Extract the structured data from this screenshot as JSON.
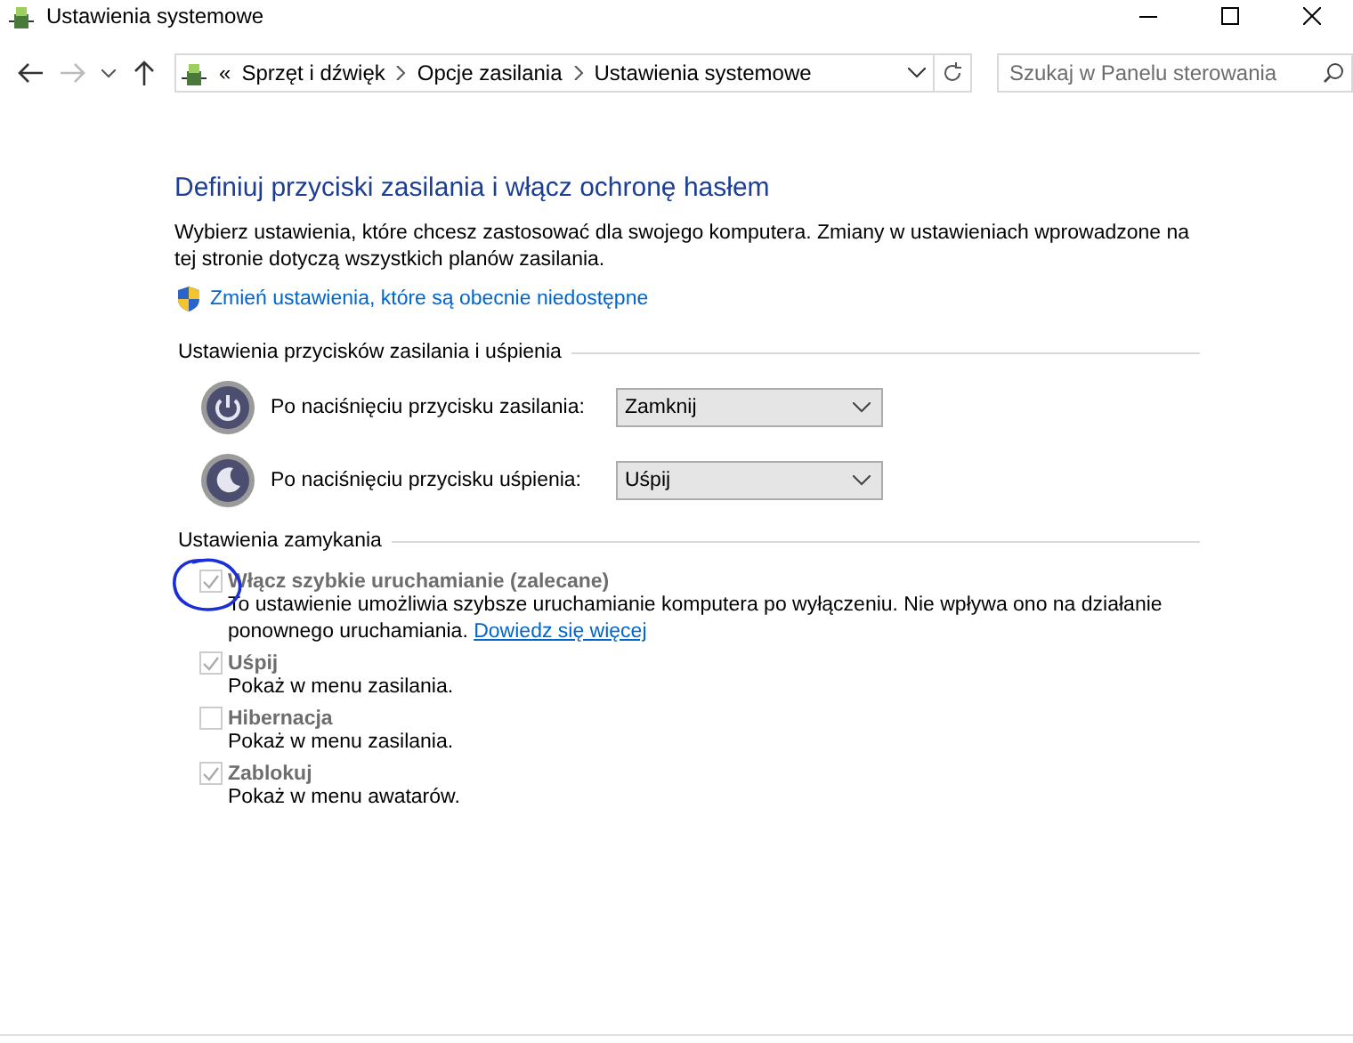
{
  "window": {
    "title": "Ustawienia systemowe"
  },
  "address_bar": {
    "overflow": "«",
    "crumbs": [
      "Sprzęt i dźwięk",
      "Opcje zasilania",
      "Ustawienia systemowe"
    ]
  },
  "search": {
    "placeholder": "Szukaj w Panelu sterowania"
  },
  "nav": {
    "back_disabled": false,
    "forward_disabled": true
  },
  "heading": "Definiuj przyciski zasilania i włącz ochronę hasłem",
  "intro": "Wybierz ustawienia, które chcesz zastosować dla swojego komputera. Zmiany w ustawieniach wprowadzone na tej stronie dotyczą wszystkich planów zasilania.",
  "admin_link": "Zmień ustawienia, które są obecnie niedostępne",
  "buttons_section": {
    "title": "Ustawienia przycisków zasilania i uśpienia",
    "rows": [
      {
        "kind": "power",
        "label": "Po naciśnięciu przycisku zasilania:",
        "value": "Zamknij"
      },
      {
        "kind": "sleep",
        "label": "Po naciśnięciu przycisku uśpienia:",
        "value": "Uśpij"
      }
    ]
  },
  "shutdown_section": {
    "title": "Ustawienia zamykania",
    "options": [
      {
        "label": "Włącz szybkie uruchamianie (zalecane)",
        "checked": true,
        "disabled": true,
        "description": "To ustawienie umożliwia szybsze uruchamianie komputera po wyłączeniu. Nie wpływa ono na działanie ponownego uruchamiania.",
        "link": "Dowiedz się więcej"
      },
      {
        "label": "Uśpij",
        "checked": true,
        "disabled": true,
        "description": "Pokaż w menu zasilania."
      },
      {
        "label": "Hibernacja",
        "checked": false,
        "disabled": true,
        "description": "Pokaż w menu zasilania."
      },
      {
        "label": "Zablokuj",
        "checked": true,
        "disabled": true,
        "description": "Pokaż w menu awatarów."
      }
    ]
  }
}
